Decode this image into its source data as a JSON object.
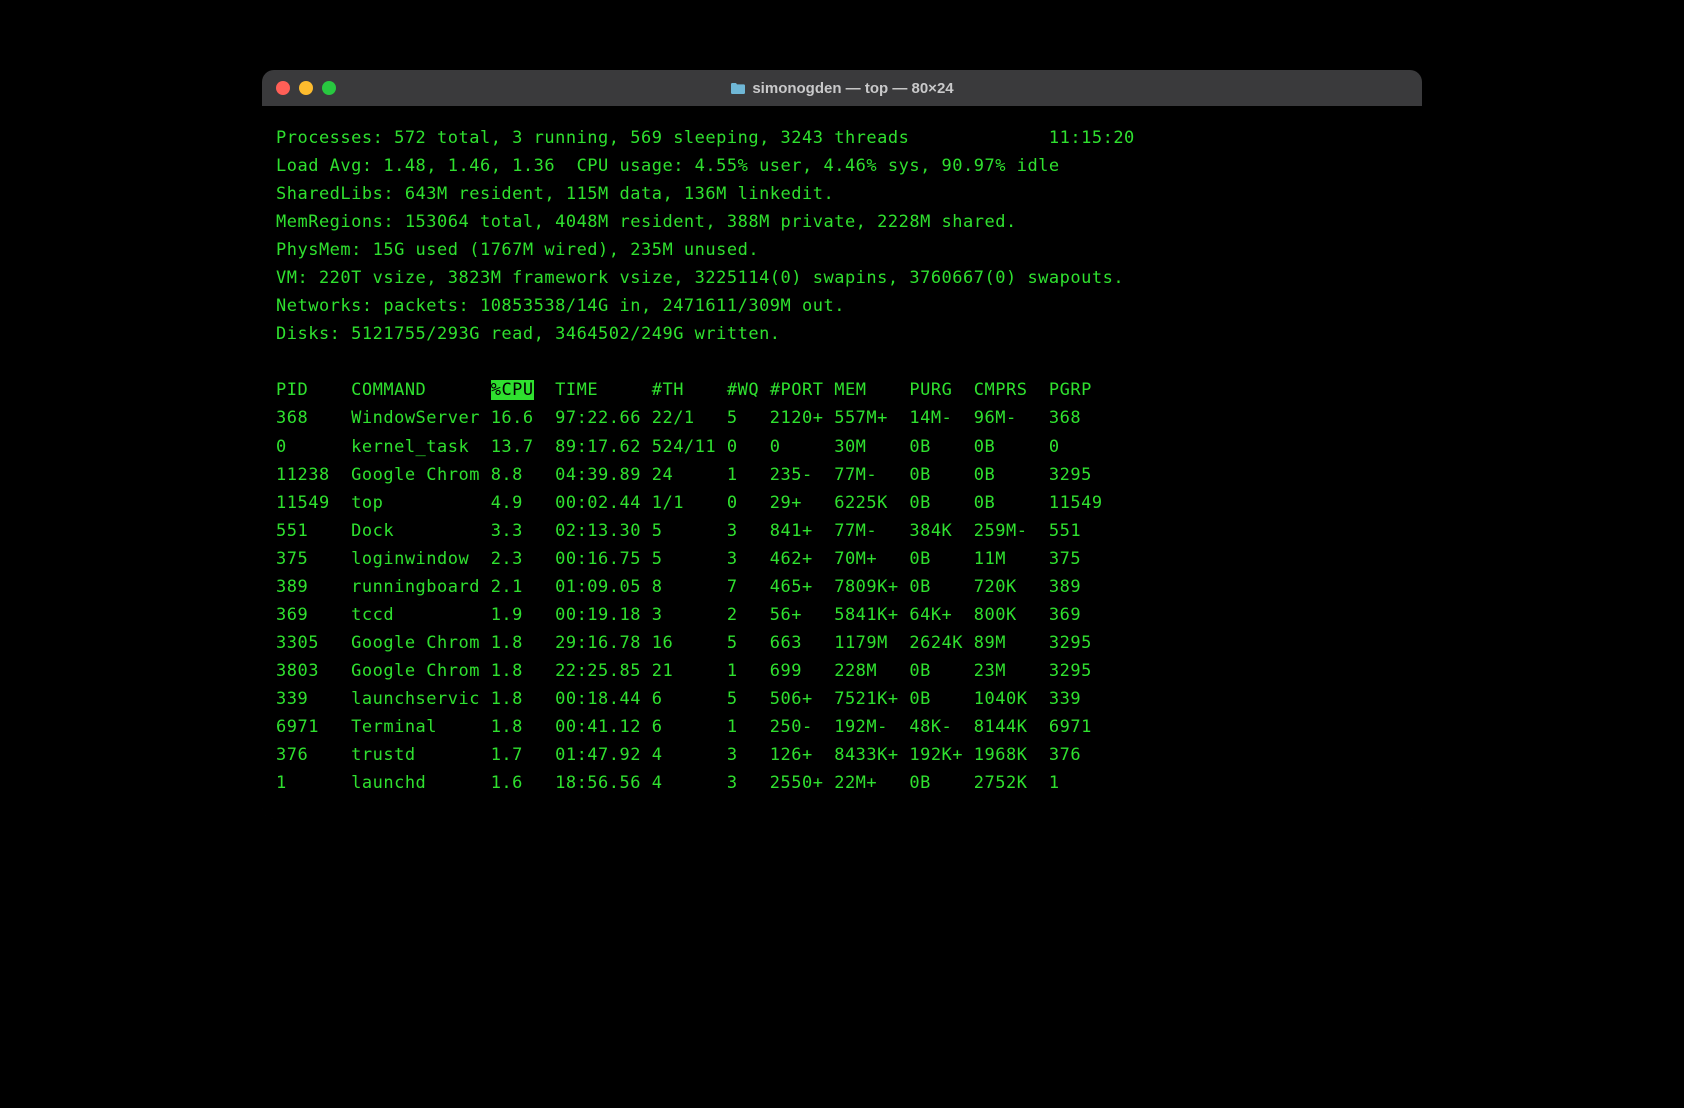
{
  "window": {
    "title": "simonogden — top — 80×24"
  },
  "summary": {
    "processes": "Processes: 572 total, 3 running, 569 sleeping, 3243 threads",
    "time": "11:15:20",
    "load_cpu": "Load Avg: 1.48, 1.46, 1.36  CPU usage: 4.55% user, 4.46% sys, 90.97% idle",
    "sharedlibs": "SharedLibs: 643M resident, 115M data, 136M linkedit.",
    "memregions": "MemRegions: 153064 total, 4048M resident, 388M private, 2228M shared.",
    "physmem": "PhysMem: 15G used (1767M wired), 235M unused.",
    "vm": "VM: 220T vsize, 3823M framework vsize, 3225114(0) swapins, 3760667(0) swapouts.",
    "networks": "Networks: packets: 10853538/14G in, 2471611/309M out.",
    "disks": "Disks: 5121755/293G read, 3464502/249G written."
  },
  "headers": {
    "pid": "PID",
    "command": "COMMAND",
    "cpu": "%CPU",
    "time": "TIME",
    "th": "#TH",
    "wq": "#WQ",
    "port": "#PORT",
    "mem": "MEM",
    "purg": "PURG",
    "cmprs": "CMPRS",
    "pgrp": "PGRP"
  },
  "rows": [
    {
      "pid": "368",
      "command": "WindowServer",
      "cpu": "16.6",
      "time": "97:22.66",
      "th": "22/1",
      "wq": "5",
      "port": "2120+",
      "mem": "557M+",
      "purg": "14M-",
      "cmprs": "96M-",
      "pgrp": "368"
    },
    {
      "pid": "0",
      "command": "kernel_task",
      "cpu": "13.7",
      "time": "89:17.62",
      "th": "524/11",
      "wq": "0",
      "port": "0",
      "mem": "30M",
      "purg": "0B",
      "cmprs": "0B",
      "pgrp": "0"
    },
    {
      "pid": "11238",
      "command": "Google Chrom",
      "cpu": "8.8",
      "time": "04:39.89",
      "th": "24",
      "wq": "1",
      "port": "235-",
      "mem": "77M-",
      "purg": "0B",
      "cmprs": "0B",
      "pgrp": "3295"
    },
    {
      "pid": "11549",
      "command": "top",
      "cpu": "4.9",
      "time": "00:02.44",
      "th": "1/1",
      "wq": "0",
      "port": "29+",
      "mem": "6225K",
      "purg": "0B",
      "cmprs": "0B",
      "pgrp": "11549"
    },
    {
      "pid": "551",
      "command": "Dock",
      "cpu": "3.3",
      "time": "02:13.30",
      "th": "5",
      "wq": "3",
      "port": "841+",
      "mem": "77M-",
      "purg": "384K",
      "cmprs": "259M-",
      "pgrp": "551"
    },
    {
      "pid": "375",
      "command": "loginwindow",
      "cpu": "2.3",
      "time": "00:16.75",
      "th": "5",
      "wq": "3",
      "port": "462+",
      "mem": "70M+",
      "purg": "0B",
      "cmprs": "11M",
      "pgrp": "375"
    },
    {
      "pid": "389",
      "command": "runningboard",
      "cpu": "2.1",
      "time": "01:09.05",
      "th": "8",
      "wq": "7",
      "port": "465+",
      "mem": "7809K+",
      "purg": "0B",
      "cmprs": "720K",
      "pgrp": "389"
    },
    {
      "pid": "369",
      "command": "tccd",
      "cpu": "1.9",
      "time": "00:19.18",
      "th": "3",
      "wq": "2",
      "port": "56+",
      "mem": "5841K+",
      "purg": "64K+",
      "cmprs": "800K",
      "pgrp": "369"
    },
    {
      "pid": "3305",
      "command": "Google Chrom",
      "cpu": "1.8",
      "time": "29:16.78",
      "th": "16",
      "wq": "5",
      "port": "663",
      "mem": "1179M",
      "purg": "2624K",
      "cmprs": "89M",
      "pgrp": "3295"
    },
    {
      "pid": "3803",
      "command": "Google Chrom",
      "cpu": "1.8",
      "time": "22:25.85",
      "th": "21",
      "wq": "1",
      "port": "699",
      "mem": "228M",
      "purg": "0B",
      "cmprs": "23M",
      "pgrp": "3295"
    },
    {
      "pid": "339",
      "command": "launchservic",
      "cpu": "1.8",
      "time": "00:18.44",
      "th": "6",
      "wq": "5",
      "port": "506+",
      "mem": "7521K+",
      "purg": "0B",
      "cmprs": "1040K",
      "pgrp": "339"
    },
    {
      "pid": "6971",
      "command": "Terminal",
      "cpu": "1.8",
      "time": "00:41.12",
      "th": "6",
      "wq": "1",
      "port": "250-",
      "mem": "192M-",
      "purg": "48K-",
      "cmprs": "8144K",
      "pgrp": "6971"
    },
    {
      "pid": "376",
      "command": "trustd",
      "cpu": "1.7",
      "time": "01:47.92",
      "th": "4",
      "wq": "3",
      "port": "126+",
      "mem": "8433K+",
      "purg": "192K+",
      "cmprs": "1968K",
      "pgrp": "376"
    },
    {
      "pid": "1",
      "command": "launchd",
      "cpu": "1.6",
      "time": "18:56.56",
      "th": "4",
      "wq": "3",
      "port": "2550+",
      "mem": "22M+",
      "purg": "0B",
      "cmprs": "2752K",
      "pgrp": "1"
    }
  ]
}
